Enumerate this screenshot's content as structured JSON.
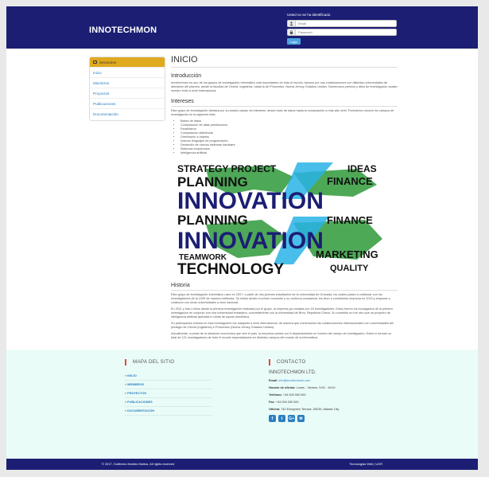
{
  "header": {
    "brand": "INNOTECHMON",
    "login_notice": "Usted no se ha identificado.",
    "email_placeholder": "Email",
    "password_placeholder": "Password",
    "login_button": "Login"
  },
  "sidebar": {
    "heading": "Secciones",
    "items": [
      {
        "label": "Inicio"
      },
      {
        "label": "Miembros"
      },
      {
        "label": "Proyectos"
      },
      {
        "label": "Publicaciones"
      },
      {
        "label": "Documentación"
      }
    ]
  },
  "content": {
    "title": "INICIO",
    "intro_title": "Introducción",
    "intro_text": "Innotechmon es uno de los grupos de investigación informático más importantes de todo el mundo, famoso por sus colaboraciones con distintas universidades de alrededor del planeta, desde la facultad de Oxford, Inglaterra, hasta la de Princenton, Nueva Jersey, Estados Unidos. Numerosos premios y altos de investigación avalan nuestro éxito a nivel internacional.",
    "interests_title": "Intereses",
    "interests_text": "Este grupo de investigación destaca por su amplio campo de intereses, desde base de datos hasta la computación a más alto nivel. Podríamos resumir los campos de investigación en la siguiente lista:",
    "interests": [
      "Bases de datos",
      "Computación de altas prestaciones",
      "Paralelismo",
      "Computación distribuida",
      "Orientación a objetos",
      "Nuevos lenguajes de programación",
      "Desarrollo de nuevos sistemas hardware",
      "Sistemas empotrados",
      "Inteligencia artificial"
    ],
    "banner_words": {
      "strategy": "STRATEGY PROJECT",
      "ideas": "IDEAS",
      "planning": "PLANNING",
      "finance": "FINANCE",
      "innovation": "INNOVATION",
      "teamwork": "TEAMWORK",
      "marketing": "MARKETING",
      "technology": "TECHNOLOGY",
      "quality": "QUALITY"
    },
    "history_title": "Historia",
    "history_p1": "Este grupo de investigación informático nace en 2007, a partir de dos jóvenes estudiantes de la universidad de Granada, los cuales pasan a colaborar con los investigadores de la UGR de manera retribuida. Su éxitos desde el primer momento y su continua constancia, les llevo a constituirse empresa en 2010 y empezar a colaborar con otras universidades a nivel nacional.",
    "history_p2": "En 2011 y tras 4 años desde la primera investigación realizada por el grupo, la empresa ya contaba con 16 investigadores. Estos fueron los encargados de la primera investigación en conjunto con una universidad extranjera, concretamente con la universidad de Brno, República Checa. Su cometido no fue otro que un proyecto de inteligencia artificial aplicada a robots de ayuda doméstica.",
    "history_p3": "Su participación exitosa en esta investigación los catapultó a nivel internacional, de manera que comenzaron las colaboraciones internacionales con universidades del prestigio de Oxford (Inglaterra) o Princenton (Nueva Jersey, Estados Unidos).",
    "history_p4": "Actualmente, a pesar de la situación económica que vive el país, la empresa cuenta con 5 departamentos en función del campo de investigación. Estos lo forman un total de 121 investigadores de todo el mundo especializados en distintos campos del mundo de la informática."
  },
  "footer": {
    "sitemap_title": "MAPA DEL SITIO",
    "sitemap": [
      {
        "label": "» INICIO"
      },
      {
        "label": "» MIEMBROS"
      },
      {
        "label": "» PROYECTOS"
      },
      {
        "label": "» PUBLICACIONES"
      },
      {
        "label": "» DOCUMENTACIÓN"
      }
    ],
    "contact_title": "CONTACTO",
    "company": "INNOTECHMON LTD.",
    "email_label": "Email:",
    "email_value": "info@innotechmon.com",
    "hours_label": "Horario de oficina:",
    "hours_value": "Lunes - Viernes, 9:00 - 19:00",
    "phone_label": "Teléfono:",
    "phone_value": "+34 000 000 000",
    "fax_label": "Fax:",
    "fax_value": "+34 000 000 000",
    "office_label": "Oficina:",
    "office_value": "742 Evergreen Terrace, 05239, Atlantic City",
    "socials": [
      {
        "icon": "facebook-icon",
        "glyph": "f"
      },
      {
        "icon": "twitter-icon",
        "glyph": "t"
      },
      {
        "icon": "google-plus-icon",
        "glyph": "G+"
      },
      {
        "icon": "email-icon",
        "glyph": "✉"
      }
    ]
  },
  "bottombar": {
    "copyright": "© 2017, Guillermo Montes Martos, All rights reserved",
    "credits": "Tecnologías Web | UGR"
  },
  "colors": {
    "navy": "#1b1e73",
    "gold": "#e0aa1e",
    "link": "#2a7fc1",
    "footer_bg": "#eafcf8",
    "footer_accent": "#e0483c"
  }
}
